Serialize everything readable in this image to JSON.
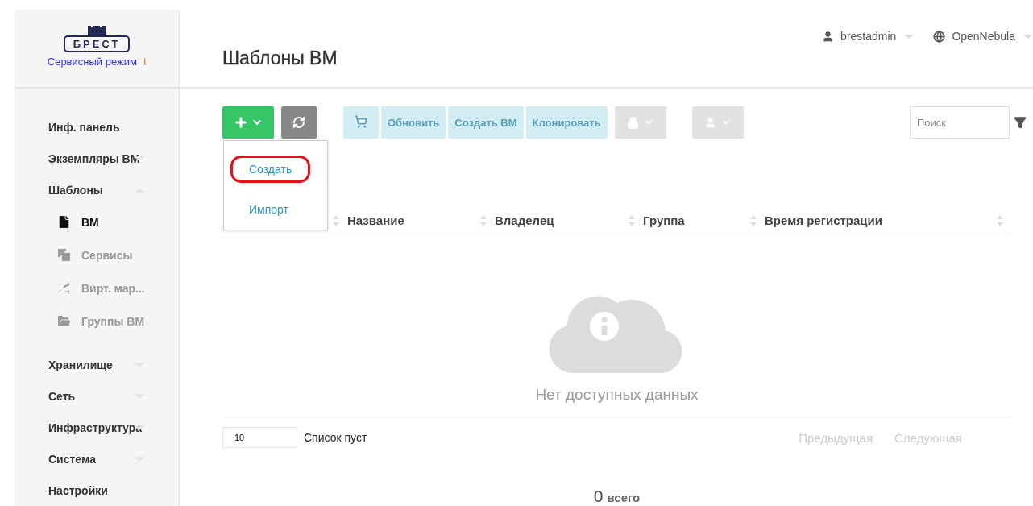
{
  "sidebar": {
    "logo": "БРЕСТ",
    "mode": "Сервисный режим",
    "mode_info": "i",
    "items": [
      {
        "label": "Инф. панель",
        "kind": "link"
      },
      {
        "label": "Экземпляры ВМ",
        "kind": "group",
        "expanded": false
      },
      {
        "label": "Шаблоны",
        "kind": "group",
        "expanded": true,
        "children": [
          {
            "label": "ВМ",
            "selected": true
          },
          {
            "label": "Сервисы",
            "selected": false
          },
          {
            "label": "Вирт. мар...",
            "selected": false
          },
          {
            "label": "Группы ВМ",
            "selected": false
          }
        ]
      },
      {
        "label": "Хранилище",
        "kind": "group",
        "expanded": false
      },
      {
        "label": "Сеть",
        "kind": "group",
        "expanded": false
      },
      {
        "label": "Инфраструктура",
        "kind": "group",
        "expanded": false
      },
      {
        "label": "Система",
        "kind": "group",
        "expanded": false
      },
      {
        "label": "Настройки",
        "kind": "link"
      }
    ]
  },
  "header": {
    "title": "Шаблоны ВМ",
    "user": "brestadmin",
    "zone": "OpenNebula"
  },
  "toolbar": {
    "create_menu_open": true,
    "menu": [
      {
        "label": "Создать",
        "highlighted": true
      },
      {
        "label": "Импорт",
        "highlighted": false
      }
    ],
    "actions": [
      {
        "kind": "icon",
        "disabled": true
      },
      {
        "kind": "text",
        "label": "Обновить",
        "disabled": true
      },
      {
        "kind": "text",
        "label": "Создать ВМ",
        "disabled": true
      },
      {
        "kind": "text",
        "label": "Клонировать",
        "disabled": true
      }
    ],
    "search": {
      "placeholder": "Поиск"
    }
  },
  "table": {
    "columns": [
      "Название",
      "Владелец",
      "Группа",
      "Время регистрации"
    ],
    "empty": "Нет доступных данных",
    "page_size": "10",
    "info": "Список пуст",
    "prev": "Предыдущая",
    "next": "Следующая"
  },
  "total": {
    "count": "0",
    "label": "всего"
  }
}
